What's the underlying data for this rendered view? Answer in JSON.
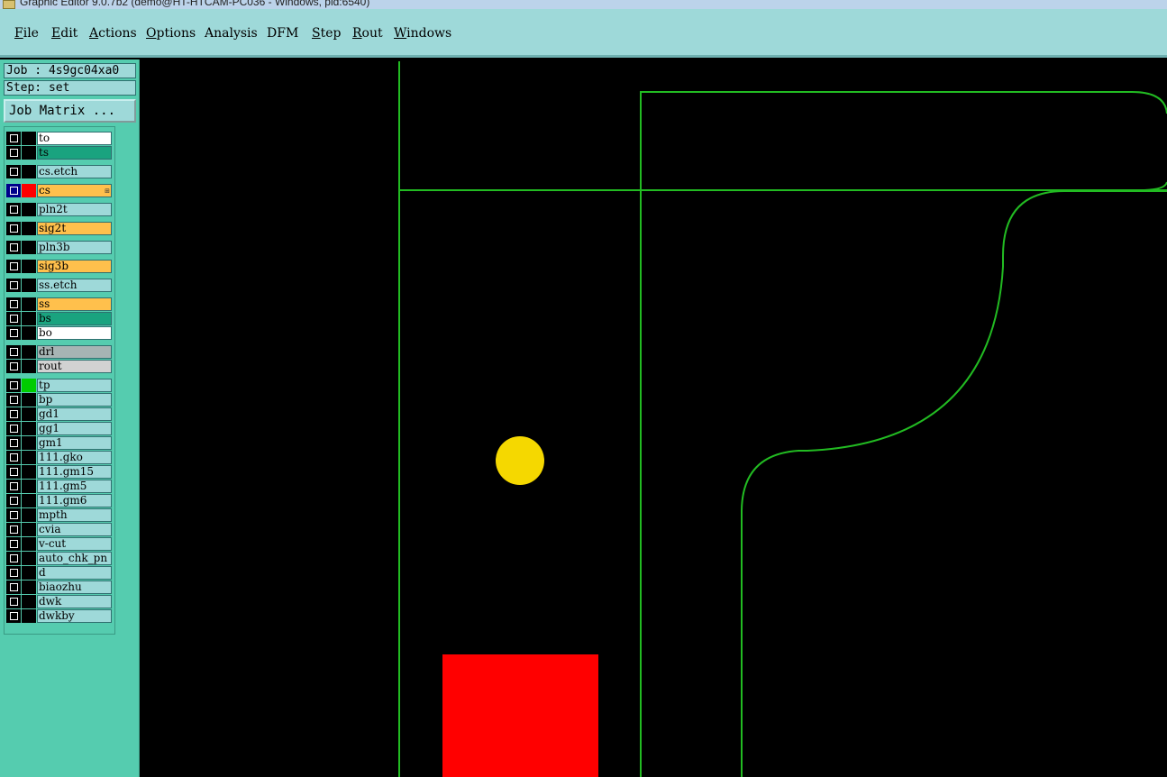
{
  "window": {
    "title": "Graphic Editor 9.0.7b2 (demo@HT-HTCAM-PC036 - Windows, pid:6540)"
  },
  "menu": [
    {
      "id": "file",
      "label": "File",
      "underline": "F",
      "rest": "ile"
    },
    {
      "id": "edit",
      "label": "Edit",
      "underline": "E",
      "rest": "dit"
    },
    {
      "id": "actions",
      "label": "Actions",
      "underline": "A",
      "rest": "ctions"
    },
    {
      "id": "options",
      "label": "Options",
      "underline": "O",
      "rest": "ptions"
    },
    {
      "id": "analysis",
      "label": "Analysis",
      "underline": "",
      "rest": "Analysis"
    },
    {
      "id": "dfm",
      "label": "DFM",
      "underline": "",
      "rest": "DFM"
    },
    {
      "id": "step",
      "label": "Step",
      "underline": "S",
      "rest": "tep"
    },
    {
      "id": "rout",
      "label": "Rout",
      "underline": "R",
      "rest": "out"
    },
    {
      "id": "windows",
      "label": "Windows",
      "underline": "W",
      "rest": "indows"
    }
  ],
  "job": {
    "job_text": "Job : 4s9gc04xa0",
    "step_text": "Step: set",
    "matrix_button": "Job Matrix ..."
  },
  "layers": [
    {
      "name": "to",
      "color": "#ffffff",
      "group": 1
    },
    {
      "name": "ts",
      "color": "#1aa37f",
      "group": 1
    },
    {
      "name": "cs.etch",
      "color": "#9ed9d9",
      "group": 2
    },
    {
      "name": "cs",
      "color": "#ffc04c",
      "group": 3,
      "work": true,
      "selected": true,
      "affected": "#ff0000"
    },
    {
      "name": "pln2t",
      "color": "#9ed9d9",
      "group": 4
    },
    {
      "name": "sig2t",
      "color": "#ffc04c",
      "group": 5
    },
    {
      "name": "pln3b",
      "color": "#9ed9d9",
      "group": 6
    },
    {
      "name": "sig3b",
      "color": "#ffc04c",
      "group": 7
    },
    {
      "name": "ss.etch",
      "color": "#9ed9d9",
      "group": 8
    },
    {
      "name": "ss",
      "color": "#ffc04c",
      "group": 9
    },
    {
      "name": "bs",
      "color": "#1aa37f",
      "group": 9
    },
    {
      "name": "bo",
      "color": "#ffffff",
      "group": 9
    },
    {
      "name": "drl",
      "color": "#a6b4b4",
      "group": 10
    },
    {
      "name": "rout",
      "color": "#d2d2d2",
      "group": 10
    },
    {
      "name": "tp",
      "color": "#9ed9d9",
      "group": 11,
      "affected": "#00cc00"
    },
    {
      "name": "bp",
      "color": "#9ed9d9",
      "group": 11
    },
    {
      "name": "gd1",
      "color": "#9ed9d9",
      "group": 11
    },
    {
      "name": "gg1",
      "color": "#9ed9d9",
      "group": 11
    },
    {
      "name": "gm1",
      "color": "#9ed9d9",
      "group": 11
    },
    {
      "name": "111.gko",
      "color": "#9ed9d9",
      "group": 11
    },
    {
      "name": "111.gm15",
      "color": "#9ed9d9",
      "group": 11
    },
    {
      "name": "111.gm5",
      "color": "#9ed9d9",
      "group": 11
    },
    {
      "name": "111.gm6",
      "color": "#9ed9d9",
      "group": 11
    },
    {
      "name": "mpth",
      "color": "#9ed9d9",
      "group": 11
    },
    {
      "name": "cvia",
      "color": "#9ed9d9",
      "group": 11
    },
    {
      "name": "v-cut",
      "color": "#9ed9d9",
      "group": 11
    },
    {
      "name": "auto_chk_pn",
      "color": "#9ed9d9",
      "group": 11
    },
    {
      "name": "d",
      "color": "#9ed9d9",
      "group": 11
    },
    {
      "name": "biaozhu",
      "color": "#9ed9d9",
      "group": 11
    },
    {
      "name": "dwk",
      "color": "#9ed9d9",
      "group": 11
    },
    {
      "name": "dwkby",
      "color": "#9ed9d9",
      "group": 11
    }
  ],
  "colors": {
    "outline": "#22bb22",
    "pad": "#f5d800",
    "rect": "#ff0000",
    "background": "#000000"
  }
}
